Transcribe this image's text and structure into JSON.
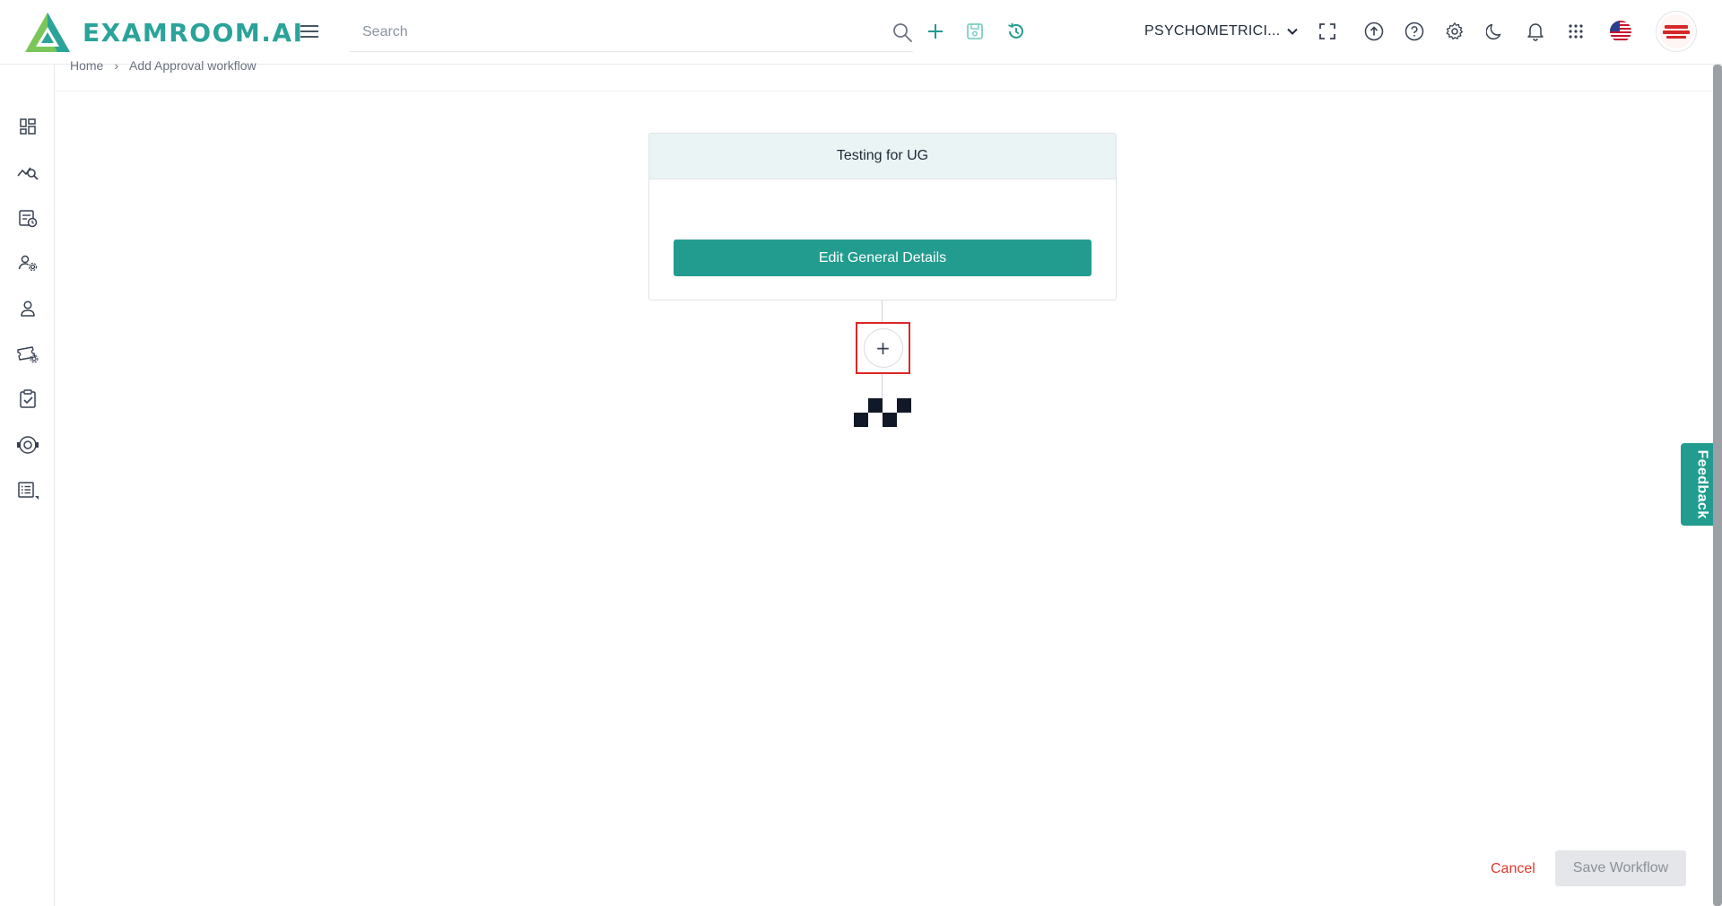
{
  "header": {
    "brand_name": "EXAMROOM.AI",
    "search_placeholder": "Search",
    "org_selector": "PSYCHOMETRICI...",
    "icons": {
      "menu": "hamburger-menu-icon",
      "search": "search-icon",
      "add": "plus-icon",
      "save": "save-icon",
      "history": "history-icon",
      "fullscreen": "fullscreen-icon",
      "upload": "upload-icon",
      "help": "help-icon",
      "settings": "gear-icon",
      "theme": "moon-icon",
      "notifications": "bell-icon",
      "apps": "apps-grid-icon",
      "language": "us-flag-icon"
    }
  },
  "breadcrumb": {
    "home": "Home",
    "current": "Add Approval workflow"
  },
  "sidebar": {
    "items": [
      {
        "name": "dashboard",
        "icon": "dashboard-icon"
      },
      {
        "name": "analytics",
        "icon": "chart-search-icon"
      },
      {
        "name": "exam-schedule",
        "icon": "calendar-clock-icon"
      },
      {
        "name": "user-settings",
        "icon": "user-gear-icon"
      },
      {
        "name": "candidates",
        "icon": "person-icon"
      },
      {
        "name": "vouchers",
        "icon": "ticket-gear-icon"
      },
      {
        "name": "approvals",
        "icon": "clipboard-check-icon"
      },
      {
        "name": "proctoring",
        "icon": "camera-gear-icon"
      },
      {
        "name": "reports",
        "icon": "list-icon"
      }
    ]
  },
  "workflow": {
    "title": "Testing for UG",
    "edit_button": "Edit General Details",
    "add_step_symbol": "+"
  },
  "footer": {
    "cancel": "Cancel",
    "save": "Save Workflow"
  },
  "feedback": {
    "label": "Feedback"
  },
  "colors": {
    "accent": "#229c8f",
    "cancel": "#dc3a2f",
    "highlight": "#dc2626",
    "disabled_bg": "#e4e6e9"
  }
}
